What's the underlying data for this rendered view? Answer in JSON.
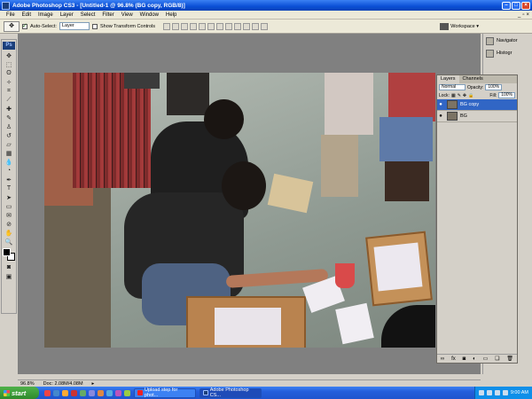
{
  "window": {
    "title": "Adobe Photoshop CS3 - [Untitled-1 @ 96.8% (BG copy, RGB/8)]"
  },
  "menu": [
    "File",
    "Edit",
    "Image",
    "Layer",
    "Select",
    "Filter",
    "View",
    "Window",
    "Help"
  ],
  "options": {
    "auto_select_label": "Auto-Select:",
    "auto_select_value": "Layer",
    "transform_label": "Show Transform Controls",
    "workspace_label": "Workspace ▾"
  },
  "dock": {
    "navigator": "Navigator",
    "histogram": "Histogr"
  },
  "layers_panel": {
    "tabs": [
      "Layers",
      "Channels"
    ],
    "blend_mode": "Normal",
    "opacity_label": "Opacity:",
    "opacity_value": "100%",
    "lock_label": "Lock:",
    "fill_label": "Fill:",
    "fill_value": "100%",
    "layers": [
      {
        "name": "BG copy",
        "selected": true
      },
      {
        "name": "BG",
        "selected": false
      }
    ]
  },
  "status": {
    "zoom": "96.8%",
    "doc": "Doc: 2.08M/4.08M"
  },
  "taskbar": {
    "start": "start",
    "tasks": [
      {
        "label": "Upload step for phot...",
        "active": false
      },
      {
        "label": "Adobe Photoshop CS...",
        "active": true
      }
    ],
    "clock": "9:00 AM"
  },
  "colors": {
    "xp_blue": "#245edb",
    "layer_selected": "#3166c5",
    "start_green": "#2e8a2b"
  }
}
